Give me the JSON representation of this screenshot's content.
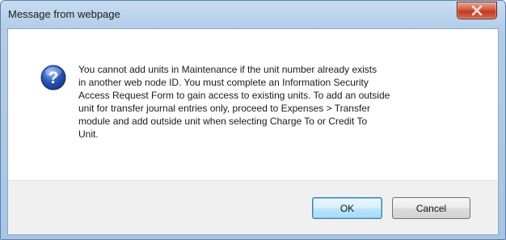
{
  "dialog": {
    "title": "Message from webpage",
    "close_icon": "close-x-icon",
    "message_icon": "question-icon",
    "message": "You cannot add units in Maintenance if the unit number already exists\nin another web node ID. You must complete an Information Security\nAccess Request Form to gain access to existing units. To add an outside\nunit for transfer journal entries only, proceed to Expenses > Transfer\nmodule and add outside unit when selecting Charge To or Credit To\nUnit.",
    "buttons": {
      "ok_label": "OK",
      "cancel_label": "Cancel"
    },
    "colors": {
      "close_button": "#c23a1f",
      "question_icon": "#2a58b8",
      "titlebar": "#b3cde9"
    }
  }
}
